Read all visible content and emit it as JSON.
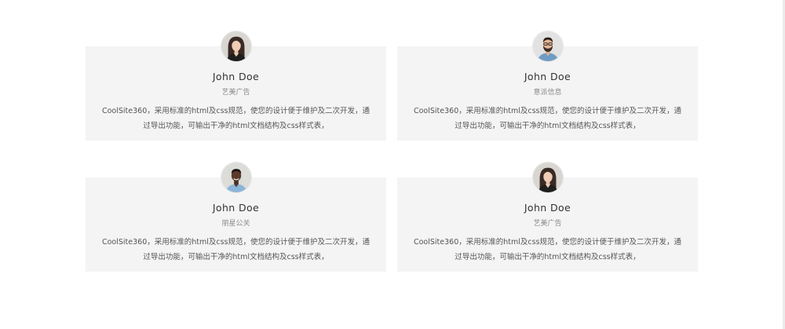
{
  "testimonials": [
    {
      "name": "John Doe",
      "company": "艺美广告",
      "description": "CoolSite360，采用标准的html及css规范，使您的设计便于维护及二次开发，通过导出功能，可输出干净的html文档结构及css样式表，",
      "avatar_icon": "woman-portrait"
    },
    {
      "name": "John Doe",
      "company": "意派信息",
      "description": "CoolSite360，采用标准的html及css规范，使您的设计便于维护及二次开发，通过导出功能，可输出干净的html文档结构及css样式表，",
      "avatar_icon": "bearded-man-with-glasses-portrait"
    },
    {
      "name": "John Doe",
      "company": "丽星公关",
      "description": "CoolSite360，采用标准的html及css规范，使您的设计便于维护及二次开发，通过导出功能，可输出干净的html文档结构及css样式表，",
      "avatar_icon": "smiling-man-portrait"
    },
    {
      "name": "John Doe",
      "company": "艺美广告",
      "description": "CoolSite360，采用标准的html及css规范，使您的设计便于维护及二次开发，通过导出功能，可输出干净的html文档结构及css样式表，",
      "avatar_icon": "woman-portrait"
    }
  ],
  "colors": {
    "card_background": "#f4f4f4",
    "name_text": "#333333",
    "company_text": "#8a8a8a",
    "description_text": "#555555"
  }
}
